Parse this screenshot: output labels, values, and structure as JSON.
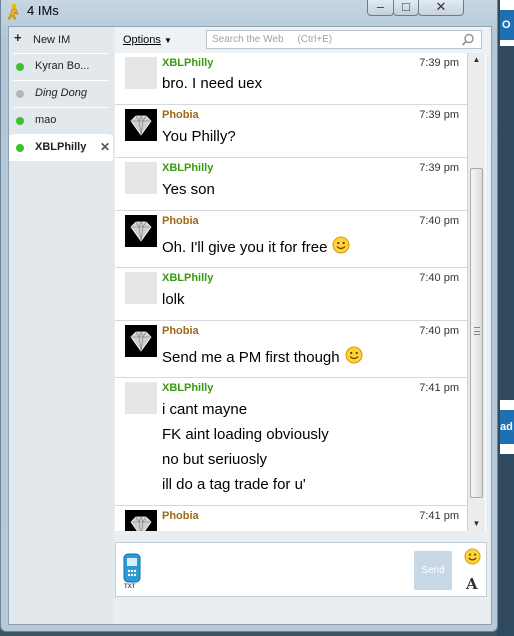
{
  "window": {
    "title": "4 IMs"
  },
  "background": {
    "chip_top": "O",
    "chip_bottom": "ad"
  },
  "sidebar": {
    "new_im_label": "New IM",
    "tabs": [
      {
        "label": "Kyran Bo...",
        "status": "online"
      },
      {
        "label": "Ding Dong",
        "status": "away"
      },
      {
        "label": "mao",
        "status": "online"
      },
      {
        "label": "XBLPhilly",
        "status": "online",
        "active": true
      }
    ]
  },
  "toolbar": {
    "options_label": "Options",
    "search_placeholder": "Search the Web     (Ctrl+E)"
  },
  "messages": [
    {
      "sender": "XBLPhilly",
      "time": "7:39 pm",
      "lines": [
        "bro. I need uex"
      ]
    },
    {
      "sender": "Phobia",
      "time": "7:39 pm",
      "lines": [
        "You Philly?"
      ]
    },
    {
      "sender": "XBLPhilly",
      "time": "7:39 pm",
      "lines": [
        "Yes son"
      ]
    },
    {
      "sender": "Phobia",
      "time": "7:40 pm",
      "lines": [
        "Oh. I'll give you it for free"
      ]
    },
    {
      "sender": "XBLPhilly",
      "time": "7:40 pm",
      "lines": [
        "lolk"
      ]
    },
    {
      "sender": "Phobia",
      "time": "7:40 pm",
      "lines": [
        "Send me a PM first though"
      ]
    },
    {
      "sender": "XBLPhilly",
      "time": "7:41 pm",
      "lines": [
        "i cant mayne",
        "FK aint loading obviously",
        "no but seriuosly",
        "ill do a tag trade for u'"
      ]
    },
    {
      "sender": "Phobia",
      "time": "7:41 pm",
      "lines": []
    }
  ],
  "input": {
    "send_label": "Send",
    "txt_label": "TXT",
    "font_label": "A"
  },
  "colors": {
    "xbl_sender": "#3a9a12",
    "phobia_sender": "#9a6a16",
    "online": "#3fbf2f",
    "away": "#b5b5b5"
  }
}
